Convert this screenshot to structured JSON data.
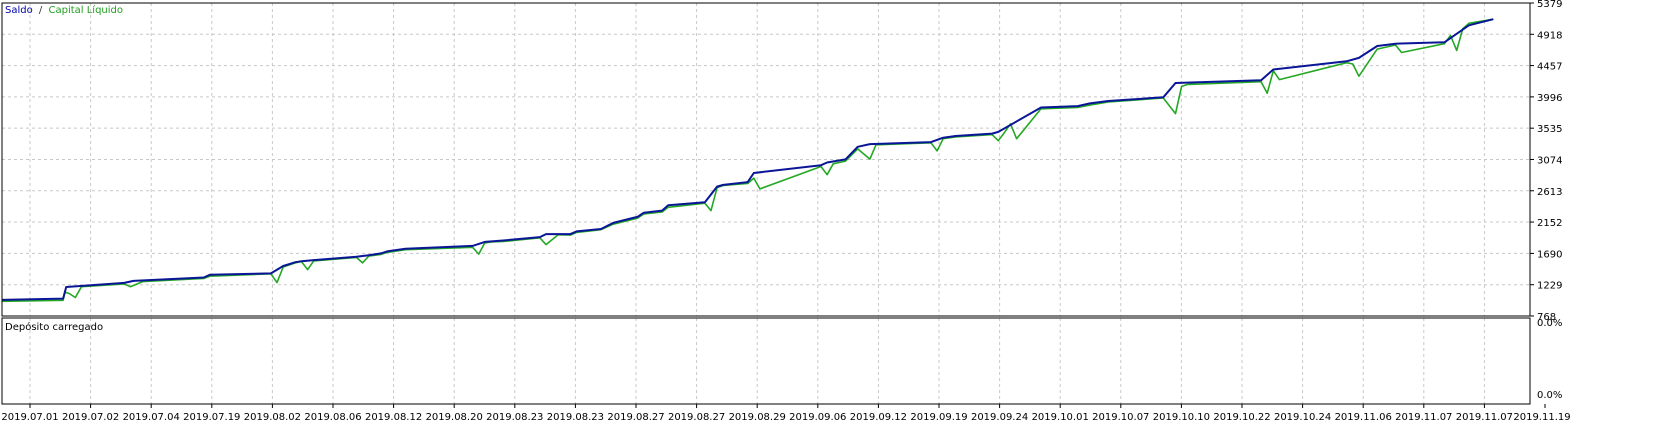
{
  "legend": {
    "balance_label": "Saldo",
    "separator": "/",
    "equity_label": "Capital Líquido"
  },
  "sub_panel": {
    "title": "Depósito carregado",
    "y_ticks": [
      "0.0%",
      "0.0%"
    ]
  },
  "colors": {
    "balance": "#0a1696",
    "equity": "#23a823",
    "grid": "#c8c8c8",
    "frame": "#000000"
  },
  "chart_data": {
    "type": "line",
    "y_ticks": [
      5379,
      4918,
      4457,
      3996,
      3535,
      3074,
      2613,
      2152,
      1690,
      1229,
      768
    ],
    "ylim": [
      768,
      5379
    ],
    "x_tick_labels": [
      "2019.07.01",
      "2019.07.02",
      "2019.07.04",
      "2019.07.19",
      "2019.08.02",
      "2019.08.06",
      "2019.08.12",
      "2019.08.20",
      "2019.08.23",
      "2019.08.23",
      "2019.08.27",
      "2019.08.27",
      "2019.08.29",
      "2019.09.06",
      "2019.09.12",
      "2019.09.19",
      "2019.09.24",
      "2019.10.01",
      "2019.10.07",
      "2019.10.10",
      "2019.10.22",
      "2019.10.24",
      "2019.11.06",
      "2019.11.07",
      "2019.11.07",
      "2019.11.19"
    ],
    "x_range": [
      0,
      250
    ],
    "series": [
      {
        "name": "Saldo",
        "x": [
          0,
          10,
          10.5,
          20,
          21.5,
          33,
          34,
          44,
          46,
          48,
          49,
          51,
          58,
          60,
          62,
          63,
          66,
          77,
          79,
          82,
          88,
          89,
          93,
          94,
          98,
          100,
          104,
          105,
          108,
          109,
          115,
          117,
          118,
          122,
          123,
          134,
          135,
          138,
          140,
          142,
          152,
          154,
          156,
          162,
          163,
          170,
          176,
          178,
          181,
          190,
          192,
          206,
          208,
          220,
          222,
          225,
          228,
          236,
          240,
          244
        ],
        "y": [
          1005,
          1025,
          1195,
          1255,
          1285,
          1335,
          1375,
          1395,
          1505,
          1560,
          1575,
          1592,
          1640,
          1662,
          1690,
          1720,
          1760,
          1800,
          1860,
          1880,
          1930,
          1975,
          1975,
          2015,
          2050,
          2140,
          2230,
          2290,
          2320,
          2400,
          2445,
          2675,
          2700,
          2740,
          2875,
          2990,
          3030,
          3075,
          3260,
          3300,
          3330,
          3395,
          3420,
          3455,
          3480,
          3840,
          3860,
          3900,
          3935,
          3990,
          4200,
          4240,
          4400,
          4520,
          4570,
          4745,
          4780,
          4800,
          5050,
          5140
        ]
      },
      {
        "name": "Capital Líquido",
        "x": [
          0,
          10,
          10.3,
          11,
          12,
          13,
          20,
          21,
          23,
          33,
          34,
          44,
          45,
          46,
          48,
          49,
          50,
          51,
          58,
          59,
          60,
          62,
          63,
          66,
          77,
          78,
          79,
          80,
          82,
          88,
          89,
          91,
          93,
          94,
          98,
          100,
          104,
          105,
          108,
          109,
          115,
          116,
          117,
          118,
          122,
          123,
          124,
          134,
          135,
          136,
          138,
          140,
          142,
          143,
          152,
          153,
          154,
          156,
          162,
          163,
          164,
          165,
          166,
          170,
          176,
          178,
          181,
          190,
          192,
          193,
          194,
          206,
          207,
          208,
          209,
          220,
          221,
          222,
          225,
          228,
          229,
          236,
          237,
          238,
          239,
          240,
          244
        ],
        "y": [
          985,
          1000,
          1120,
          1100,
          1040,
          1200,
          1240,
          1200,
          1275,
          1320,
          1355,
          1390,
          1260,
          1490,
          1550,
          1570,
          1450,
          1580,
          1630,
          1550,
          1650,
          1675,
          1705,
          1745,
          1780,
          1680,
          1845,
          1860,
          1865,
          1920,
          1820,
          1965,
          1960,
          2000,
          2040,
          2120,
          2210,
          2270,
          2300,
          2370,
          2430,
          2320,
          2660,
          2690,
          2720,
          2800,
          2640,
          2970,
          2850,
          3010,
          3050,
          3230,
          3080,
          3290,
          3320,
          3200,
          3380,
          3405,
          3440,
          3350,
          3470,
          3600,
          3380,
          3820,
          3840,
          3875,
          3920,
          3980,
          3750,
          4150,
          4180,
          4220,
          4050,
          4380,
          4250,
          4500,
          4480,
          4300,
          4700,
          4760,
          4650,
          4780,
          4900,
          4680,
          5000,
          5080,
          5140
        ]
      }
    ]
  }
}
